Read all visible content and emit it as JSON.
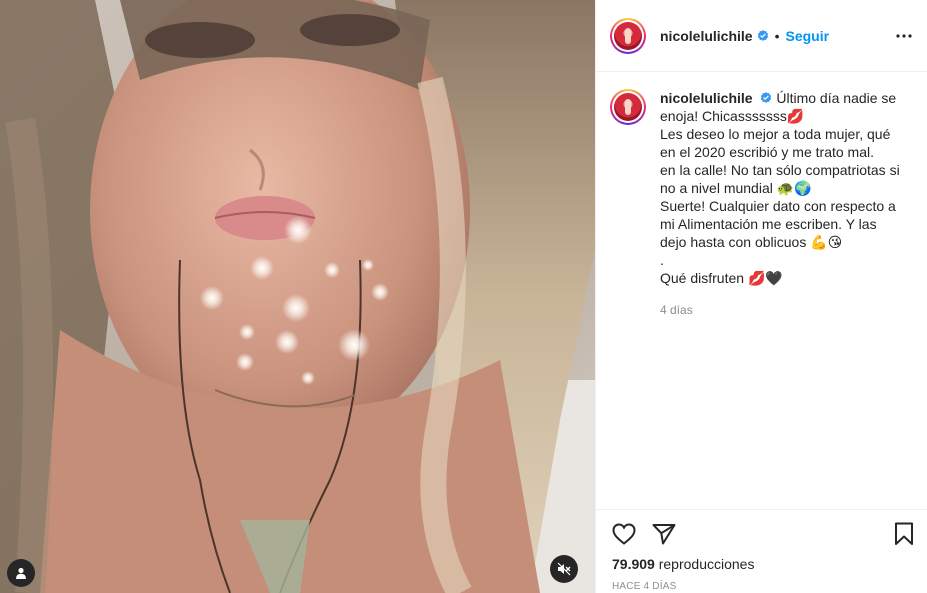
{
  "post": {
    "username": "nicolelulichile",
    "follow_label": "Seguir",
    "separator": "•",
    "caption_first": "Último día nadie se enoja! Chicasssssss💋",
    "caption_lines": [
      "Les deseo lo mejor a toda mujer, qué",
      "en el 2020 escribió y me trato mal.",
      "en la calle! No tan sólo compatriotas si",
      "no a nivel mundial 🐢🌍",
      "Suerte! Cualquier dato con respecto a",
      "mi Alimentación me escriben. Y las",
      "dejo hasta con oblicuos 💪😘",
      ".",
      "Qué disfruten 💋🖤"
    ],
    "comment_time": "4 días",
    "views_count": "79.909",
    "views_label": "reproducciones",
    "date_label": "HACE 4 DÍAS"
  },
  "icons": {
    "verified": "verified-badge-icon",
    "more": "more-options-icon",
    "like": "heart-icon",
    "share": "paper-plane-icon",
    "save": "bookmark-icon",
    "user_tag": "user-tag-icon",
    "mute": "speaker-muted-icon"
  },
  "colors": {
    "accent": "#0095f6",
    "text": "#262626",
    "muted": "#8e8e8e",
    "border": "#efefef"
  }
}
